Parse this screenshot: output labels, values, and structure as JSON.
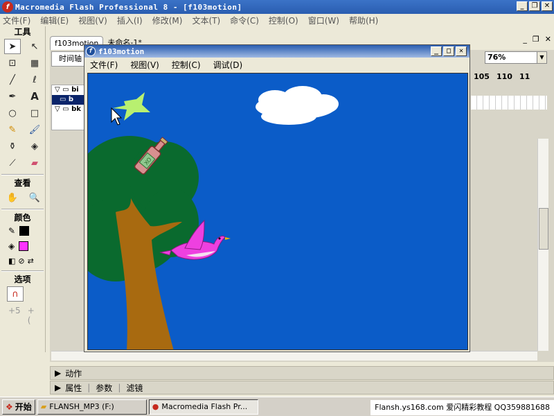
{
  "app": {
    "title": "Macromedia Flash Professional 8 - [f103motion]",
    "icon_letter": "f"
  },
  "menu": [
    "文件(F)",
    "编辑(E)",
    "视图(V)",
    "插入(I)",
    "修改(M)",
    "文本(T)",
    "命令(C)",
    "控制(O)",
    "窗口(W)",
    "帮助(H)"
  ],
  "tools": {
    "title": "工具",
    "view_title": "查看",
    "colors_title": "颜色",
    "options_title": "选项",
    "stroke_color": "#000000",
    "fill_color": "#ff33ff"
  },
  "document": {
    "tabs": [
      "f103motion",
      "未命名-1*"
    ],
    "timeline_label": "时间轴",
    "layers": [
      "bi",
      "b",
      "bk"
    ],
    "zoom": "76%",
    "ruler": [
      "105",
      "110",
      "11"
    ]
  },
  "panels": {
    "actions": "动作",
    "properties": "属性",
    "parameters": "参数",
    "filters": "滤镜"
  },
  "player": {
    "title": "f103motion",
    "menu": [
      "文件(F)",
      "视图(V)",
      "控制(C)",
      "调试(D)"
    ],
    "bottle_label": "XO",
    "stage_color": "#0b5cc8"
  },
  "taskbar": {
    "start": "开始",
    "items": [
      "FLANSH_MP3 (F:)",
      "Macromedia Flash Pr..."
    ],
    "tray": "Flansh.ys168.com 爱闪精彩教程 QQ359881688"
  }
}
